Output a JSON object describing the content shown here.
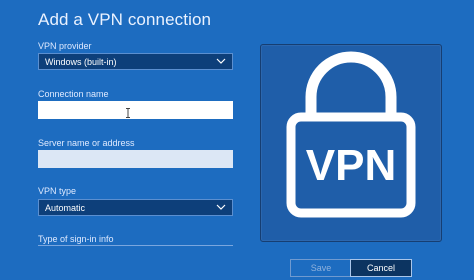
{
  "dialog": {
    "title": "Add a VPN connection"
  },
  "vpn_provider": {
    "label": "VPN provider",
    "value": "Windows (built-in)"
  },
  "connection_name": {
    "label": "Connection name",
    "value": ""
  },
  "server": {
    "label": "Server name or address",
    "value": ""
  },
  "vpn_type": {
    "label": "VPN type",
    "value": "Automatic"
  },
  "sign_in": {
    "label": "Type of sign-in info"
  },
  "illustration": {
    "text": "VPN",
    "icon": "padlock-icon"
  },
  "buttons": {
    "save": "Save",
    "cancel": "Cancel"
  },
  "colors": {
    "background": "#1d6cc0",
    "card": "#1f5ea9",
    "lock": "#ffffff"
  }
}
